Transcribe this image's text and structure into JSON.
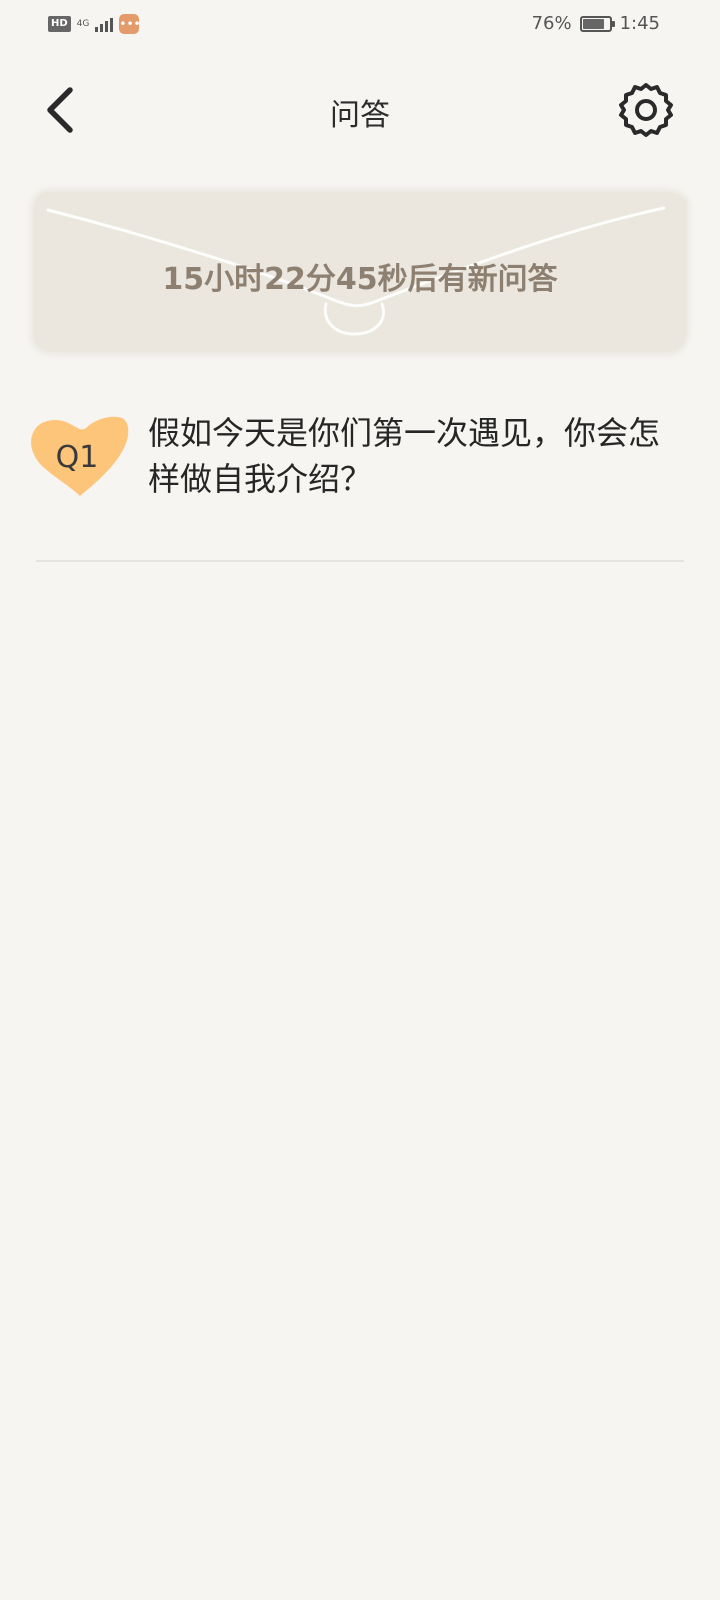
{
  "status_bar": {
    "hd": "HD",
    "network": "4G",
    "battery_percent_text": "76%",
    "battery_level": 0.76,
    "time": "1:45",
    "msg_icon": "chat-bubble-icon"
  },
  "header": {
    "title": "问答",
    "back_icon": "chevron-left-icon",
    "settings_icon": "gear-icon"
  },
  "banner": {
    "countdown_text": "15小时22分45秒后有新问答"
  },
  "questions": [
    {
      "badge": "Q1",
      "text": "假如今天是你们第一次遇见，你会怎样做自我介绍？"
    }
  ],
  "colors": {
    "background": "#f6f5f2",
    "banner": "#ebe7df",
    "countdown_text": "#8e8070",
    "badge": "#fcc57a"
  }
}
